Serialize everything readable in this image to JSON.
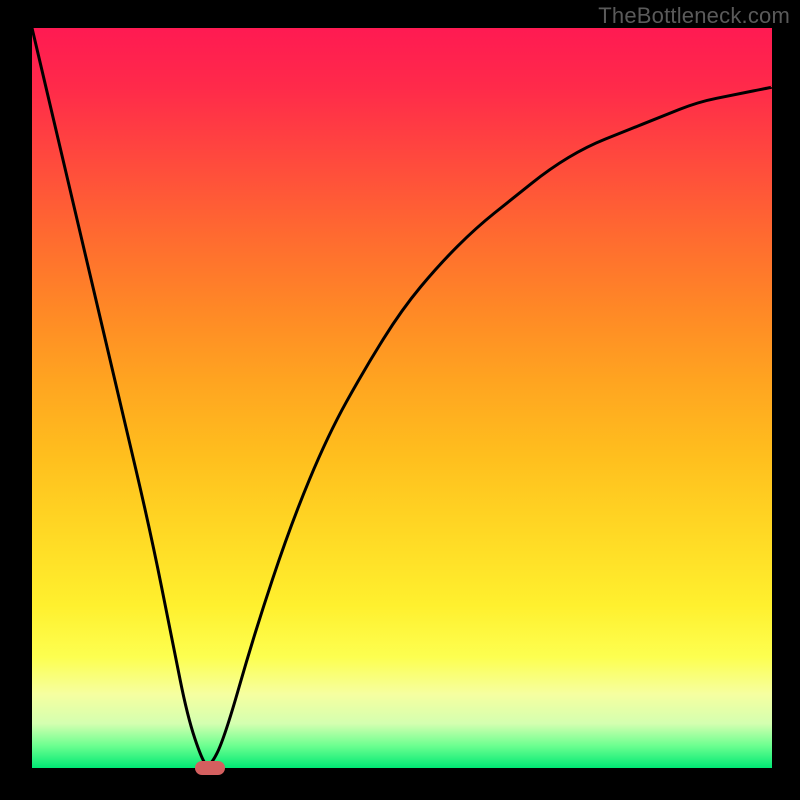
{
  "watermark": "TheBottleneck.com",
  "colors": {
    "gradient_top": "#ff1a52",
    "gradient_bottom": "#00e874",
    "curve": "#000000",
    "marker": "#d45f5f",
    "frame": "#000000"
  },
  "chart_data": {
    "type": "line",
    "title": "",
    "xlabel": "",
    "ylabel": "",
    "xlim": [
      0,
      100
    ],
    "ylim": [
      0,
      100
    ],
    "grid": false,
    "legend": false,
    "series": [
      {
        "name": "bottleneck-curve",
        "x": [
          0,
          4,
          8,
          12,
          16,
          19,
          21,
          23,
          24,
          26,
          30,
          35,
          40,
          45,
          50,
          55,
          60,
          65,
          70,
          75,
          80,
          85,
          90,
          95,
          100
        ],
        "values": [
          100,
          83,
          66,
          49,
          32,
          17,
          7,
          1,
          0,
          4,
          18,
          33,
          45,
          54,
          62,
          68,
          73,
          77,
          81,
          84,
          86,
          88,
          90,
          91,
          92
        ]
      }
    ],
    "annotations": [
      {
        "name": "min-marker",
        "x": 24,
        "y": 0,
        "shape": "pill",
        "color": "#d45f5f"
      }
    ]
  }
}
